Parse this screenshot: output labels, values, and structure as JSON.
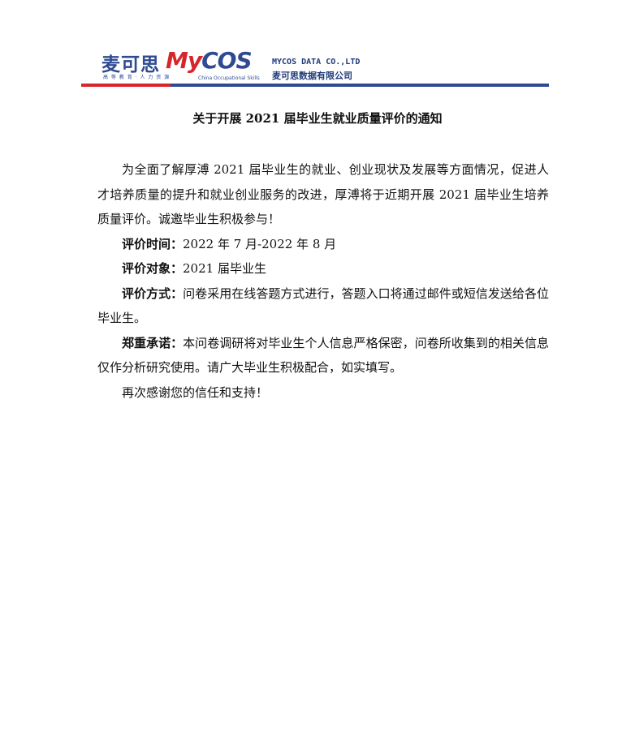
{
  "header": {
    "logo_cn": "麦可思",
    "logo_tagline": "高 等 教 育 · 人 力 资 源",
    "logo_mycos_part1": "My",
    "logo_mycos_part2": "COS",
    "logo_sub": "China Occupational Skills",
    "company_en": "MYCOS DATA CO.,LTD",
    "company_cn": "麦可思数据有限公司",
    "colors": {
      "red": "#d7262b",
      "blue": "#2e4a93"
    }
  },
  "document": {
    "title": "关于开展 2021 届毕业生就业质量评价的通知",
    "intro": "为全面了解厚溥 2021 届毕业生的就业、创业现状及发展等方面情况，促进人才培养质量的提升和就业创业服务的改进，厚溥将于近期开展 2021 届毕业生培养质量评价。诚邀毕业生积极参与！",
    "time_label": "评价时间：",
    "time_value": "2022 年 7 月-2022 年 8 月",
    "target_label": "评价对象：",
    "target_value": "2021 届毕业生",
    "method_label": "评价方式：",
    "method_value": "问卷采用在线答题方式进行，答题入口将通过邮件或短信发送给各位毕业生。",
    "promise_label": "郑重承诺：",
    "promise_value": "本问卷调研将对毕业生个人信息严格保密，问卷所收集到的相关信息仅作分析研究使用。请广大毕业生积极配合，如实填写。",
    "closing": "再次感谢您的信任和支持！"
  }
}
